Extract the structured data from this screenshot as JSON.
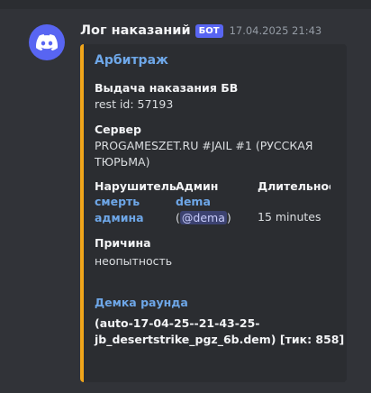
{
  "message": {
    "author": "Лог наказаний",
    "bot_badge": "БОТ",
    "timestamp": "17.04.2025 21:43",
    "avatar_icon": "discord-logo-icon",
    "avatar_color": "#5865f2"
  },
  "embed": {
    "accent_color": "#f0a51a",
    "title": "Арбитраж",
    "heading": "Выдача наказания БВ",
    "rest_id": "rest id: 57193",
    "server": {
      "name": "Сервер",
      "value": "PROGAMESZET.RU #JAIL #1 (РУССКАЯ ТЮРЬМА)"
    },
    "offender": {
      "name": "Нарушитель",
      "value": "смерть админа"
    },
    "admin": {
      "name": "Админ",
      "link": "dema",
      "paren_open": "(",
      "mention": "@dema",
      "paren_close": ")"
    },
    "duration": {
      "name": "Длительность",
      "value": "15 minutes"
    },
    "reason": {
      "name": "Причина",
      "value": "неопытность"
    },
    "demo": {
      "title": "Демка раунда",
      "value": "(auto-17-04-25--21-43-25-jb_desertstrike_pgz_6b.dem) [тик: 858]"
    }
  }
}
